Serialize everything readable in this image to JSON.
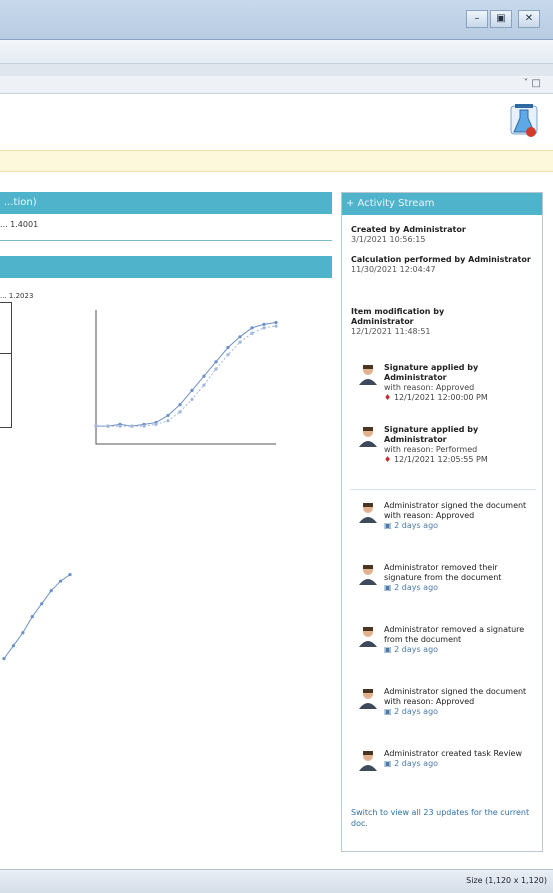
{
  "window": {
    "minimize_glyph": "–",
    "maximize_glyph": "▣",
    "close_glyph": "✕"
  },
  "subbar": {
    "pin_glyph": "˅ □"
  },
  "main_panel": {
    "header": "...tion)",
    "info": "... 1.4001",
    "date": "... 1.2023"
  },
  "charts": [
    {
      "chart_data": {
        "type": "scatter",
        "title": "",
        "xlabel": "",
        "ylabel": "",
        "series": [
          {
            "x": [
              1,
              2,
              3,
              4,
              5,
              6,
              7,
              8,
              9,
              10,
              11,
              12,
              13,
              14,
              15,
              16
            ],
            "values": [
              1.0,
              1.0,
              1.1,
              1.0,
              1.1,
              1.2,
              1.6,
              2.2,
              3.0,
              3.8,
              4.6,
              5.4,
              6.0,
              6.5,
              6.7,
              6.8
            ]
          },
          {
            "x": [
              1,
              2,
              3,
              4,
              5,
              6,
              7,
              8,
              9,
              10,
              11,
              12,
              13,
              14,
              15,
              16
            ],
            "values": [
              1.0,
              1.0,
              1.0,
              1.0,
              1.0,
              1.1,
              1.3,
              1.8,
              2.5,
              3.3,
              4.2,
              5.0,
              5.7,
              6.2,
              6.5,
              6.6
            ]
          }
        ]
      }
    },
    {
      "chart_data": {
        "type": "scatter",
        "title": "",
        "series": [
          {
            "x": [
              1,
              2,
              3,
              4,
              5,
              6,
              7,
              8
            ],
            "values": [
              3.2,
              3.6,
              4.0,
              4.5,
              4.9,
              5.3,
              5.6,
              5.8
            ]
          }
        ]
      }
    }
  ],
  "activity": {
    "title": "+ Activity Stream",
    "events": [
      {
        "label": "Created by Administrator",
        "meta": "3/1/2021 10:56:15"
      },
      {
        "label": "Calculation performed by Administrator",
        "meta": "11/30/2021 12:04:47"
      },
      {
        "label": "Item modification by Administrator",
        "meta": "12/1/2021 11:48:51"
      }
    ],
    "signatures": [
      {
        "title": "Signature applied by",
        "name": "Administrator",
        "meaning": "with reason: Approved",
        "date": "12/1/2021 12:00:00 PM"
      },
      {
        "title": "Signature applied by",
        "name": "Administrator",
        "meaning": "with reason: Performed",
        "date": "12/1/2021 12:05:55 PM"
      }
    ],
    "feed": [
      {
        "text": "Administrator signed the document with reason: Approved",
        "ago": "2 days ago"
      },
      {
        "text": "Administrator removed their signature from the document",
        "ago": "2 days ago"
      },
      {
        "text": "Administrator removed a signature from the document",
        "ago": "2 days ago"
      },
      {
        "text": "Administrator signed the document with reason: Approved",
        "ago": "2 days ago"
      },
      {
        "text": "Administrator created task Review",
        "ago": "2 days ago"
      }
    ],
    "view_all": "Switch to view all 23 updates for the current doc."
  },
  "status": {
    "size_text": "Size (1,120 x 1,120)"
  }
}
